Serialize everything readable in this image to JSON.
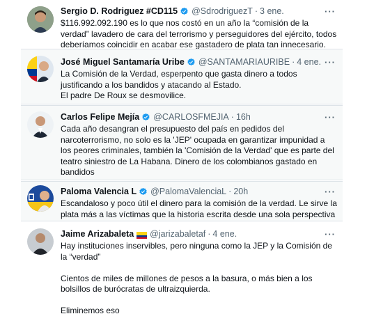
{
  "tweets": [
    {
      "name": "Sergio D. Rodriguez #CD115",
      "verified": true,
      "handle": "@SdrodriguezT",
      "time": "3 ene.",
      "more": "···",
      "text": [
        "$116.992.092.190 es lo que nos costó en un año la “comisión de la verdad” lavadero de cara del terrorismo y perseguidores del ejército, todos deberíamos coincidir en acabar ese gastadero de plata tan innecesario."
      ]
    },
    {
      "name": "José Miguel Santamaría Uribe",
      "verified": true,
      "handle": "@SANTAMARIAURIBE",
      "time": "4 ene.",
      "more": "···",
      "text": [
        "La Comisión de la Verdad, esperpento que gasta dinero a todos justificando a los bandidos y atacando al Estado.",
        "El padre De Roux se desmovilice."
      ]
    },
    {
      "name": "Carlos Felipe Mejía",
      "verified": true,
      "handle": "@CARLOSFMEJIA",
      "time": "16h",
      "more": "···",
      "text": [
        "Cada año desangran el presupuesto del país en pedidos del narcoterrorismo, no solo es la 'JEP' ocupada en garantizar impunidad a los peores criminales, también la 'Comisión de la Verdad' que es parte del teatro siniestro de La Habana. Dinero de los colombianos gastado en bandidos"
      ]
    },
    {
      "name": "Paloma Valencia L",
      "verified": true,
      "handle": "@PalomaValenciaL",
      "time": "20h",
      "more": "···",
      "text": [
        "Escandaloso y poco útil el dinero para la comisión de la verdad. Le sirve la plata más a las víctimas que la historia escrita desde una sola perspectiva ."
      ]
    },
    {
      "name": "Jaime Arizabaleta",
      "verified": false,
      "handle": "@jarizabaletaf",
      "time": "4 ene.",
      "more": "···",
      "text": [
        "Hay instituciones inservibles, pero ninguna como la JEP y la Comisión de la “verdad”",
        "",
        "Cientos de miles de millones de pesos a la basura, o más bien a los bolsillos de burócratas de ultraizquierda.",
        "",
        "Eliminemos eso"
      ]
    }
  ],
  "colors": {
    "verified_blue": "#1d9bf0",
    "secondary_text": "#536471",
    "shaded_bg": "#f7f9f9",
    "flag_yellow": "#fcd116",
    "flag_blue": "#003893",
    "flag_red": "#ce1126"
  }
}
